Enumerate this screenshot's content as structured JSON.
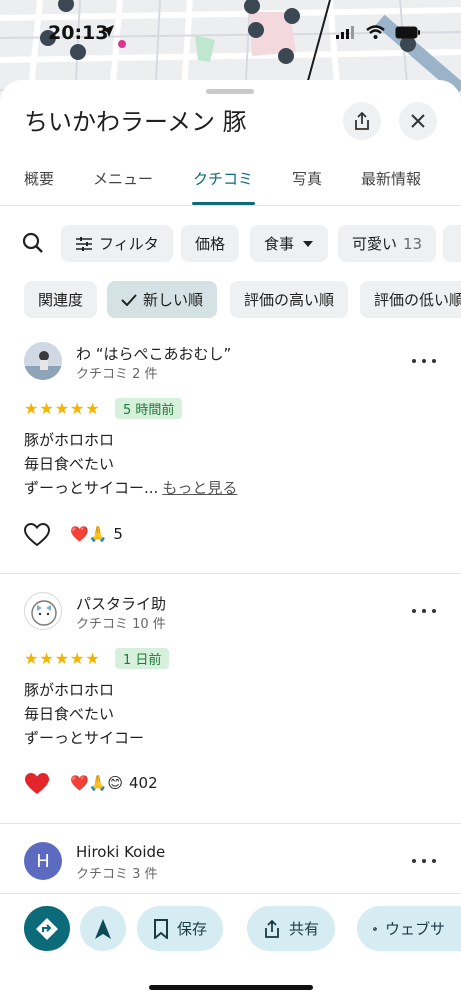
{
  "status": {
    "time": "20:13"
  },
  "place": {
    "title": "ちいかわラーメン 豚"
  },
  "tabs": [
    {
      "label": "概要"
    },
    {
      "label": "メニュー"
    },
    {
      "label": "クチコミ"
    },
    {
      "label": "写真"
    },
    {
      "label": "最新情報"
    }
  ],
  "filters": {
    "row1": [
      {
        "label": "フィルタ"
      },
      {
        "label": "価格"
      },
      {
        "label": "食事"
      },
      {
        "label": "可愛い",
        "count": "13"
      }
    ],
    "row2": [
      {
        "label": "関連度"
      },
      {
        "label": "新しい順"
      },
      {
        "label": "評価の高い順"
      },
      {
        "label": "評価の低い順"
      }
    ]
  },
  "reviews": [
    {
      "name": "わ “はらぺこあおむし”",
      "sub": "クチコミ 2 件",
      "stars": "★★★★★",
      "time": "5 時間前",
      "lines": [
        "豚がホロホロ",
        "毎日食べたい",
        "ずーっとサイコー..."
      ],
      "more": "もっと見る",
      "reaction_emoji": "❤️🙏",
      "reaction_count": "5"
    },
    {
      "name": "パスタライ助",
      "sub": "クチコミ 10 件",
      "stars": "★★★★★",
      "time": "1 日前",
      "lines": [
        "豚がホロホロ",
        "毎日食べたい",
        "ずーっとサイコー"
      ],
      "reaction_emoji": "❤️🙏😊",
      "reaction_count": "402"
    },
    {
      "name": "Hiroki Koide",
      "sub": "クチコミ 3 件",
      "avatar_letter": "H"
    }
  ],
  "actions": [
    {
      "label": "保存"
    },
    {
      "label": "共有"
    },
    {
      "label": "ウェブサ"
    }
  ],
  "colors": {
    "accent": "#0b6b78",
    "star": "#f4b400",
    "badge_bg": "#d7f0dc",
    "action_bg": "#d5ecf3",
    "heart_red": "#e2262c"
  }
}
